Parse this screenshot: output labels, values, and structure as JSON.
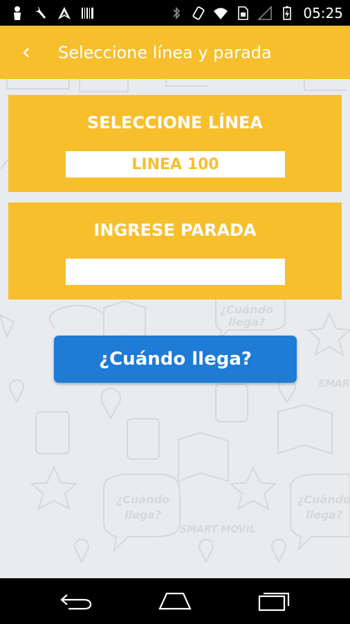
{
  "status_bar": {
    "left_icons": [
      "person-icon",
      "wrench-icon",
      "navigation-icon",
      "barcode-icon"
    ],
    "right_icons": [
      "bluetooth-icon",
      "rotate-icon",
      "wifi-icon",
      "sim-icon",
      "signal-icon",
      "battery-icon"
    ],
    "time": "05:25"
  },
  "app_bar": {
    "back_icon": "chevron-left-icon",
    "title": "Seleccione línea y parada",
    "background": "#f8bf2d"
  },
  "line_card": {
    "title": "SELECCIONE LÍNEA",
    "value": "LINEA 100"
  },
  "stop_card": {
    "title": "INGRESE PARADA",
    "value": ""
  },
  "cta": {
    "label": "¿Cuándo llega?",
    "color": "#1e7bd6"
  },
  "nav_bar": {
    "icons": [
      "back-icon",
      "home-icon",
      "recents-icon"
    ]
  }
}
